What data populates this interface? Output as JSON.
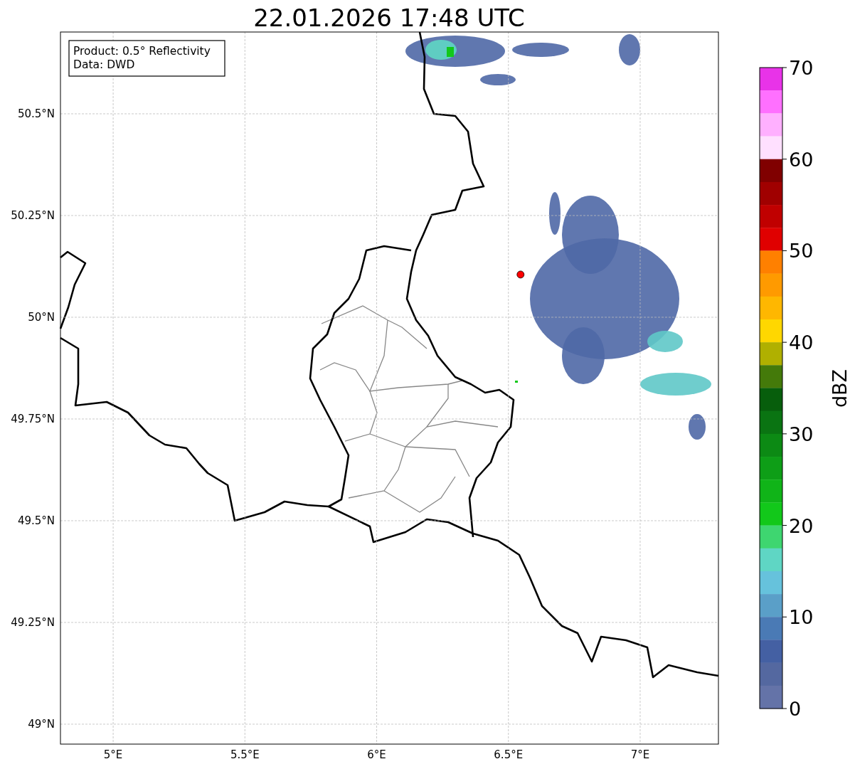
{
  "title": "22.01.2026 17:48 UTC",
  "info_box": {
    "lines": [
      "Product: 0.5° Reflectivity",
      "Data: DWD"
    ]
  },
  "map": {
    "chart_data": {
      "type": "scatter",
      "grid": true,
      "xlim": [
        4.8,
        7.297
      ],
      "ylim": [
        48.951,
        50.701
      ],
      "xticks": [
        {
          "value": 5,
          "label": "5°E"
        },
        {
          "value": 5.5,
          "label": "5.5°E"
        },
        {
          "value": 6,
          "label": "6°E"
        },
        {
          "value": 6.5,
          "label": "6.5°E"
        },
        {
          "value": 7,
          "label": "7°E"
        }
      ],
      "yticks": [
        {
          "value": 50.5,
          "label": "50.5°N"
        },
        {
          "value": 50.25,
          "label": "50.25°N"
        },
        {
          "value": 50,
          "label": "50°N"
        },
        {
          "value": 49.75,
          "label": "49.75°N"
        },
        {
          "value": 49.5,
          "label": "49.5°N"
        },
        {
          "value": 49.25,
          "label": "49.25°N"
        },
        {
          "value": 49,
          "label": "49°N"
        }
      ],
      "x": [
        6.546
      ],
      "series": [
        {
          "color": "#ff0000",
          "values": [
            50.105
          ]
        }
      ]
    }
  },
  "colorbar": {
    "label": "dBZ",
    "ticks": [
      "70",
      "60",
      "50",
      "40",
      "30",
      "20",
      "10",
      "0"
    ],
    "levels": [
      {
        "color": "#e833e8"
      },
      {
        "color": "#ff70ff"
      },
      {
        "color": "#ffb0ff"
      },
      {
        "color": "#ffe0ff"
      },
      {
        "color": "#800000"
      },
      {
        "color": "#a00000"
      },
      {
        "color": "#c00000"
      },
      {
        "color": "#e00000"
      },
      {
        "color": "#ff8000"
      },
      {
        "color": "#ff9a00"
      },
      {
        "color": "#ffb700"
      },
      {
        "color": "#ffd700"
      },
      {
        "color": "#b0b000"
      },
      {
        "color": "#447a0a"
      },
      {
        "color": "#075e0c"
      },
      {
        "color": "#0a7412"
      },
      {
        "color": "#0c8a14"
      },
      {
        "color": "#0e9e17"
      },
      {
        "color": "#10b418"
      },
      {
        "color": "#12c81a"
      },
      {
        "color": "#3ed670"
      },
      {
        "color": "#5fd6c4"
      },
      {
        "color": "#66c2dc"
      },
      {
        "color": "#5a9fc8"
      },
      {
        "color": "#4a7ab5"
      },
      {
        "color": "#4460a3"
      },
      {
        "color": "#5468a0"
      },
      {
        "color": "#6473a8"
      }
    ]
  }
}
